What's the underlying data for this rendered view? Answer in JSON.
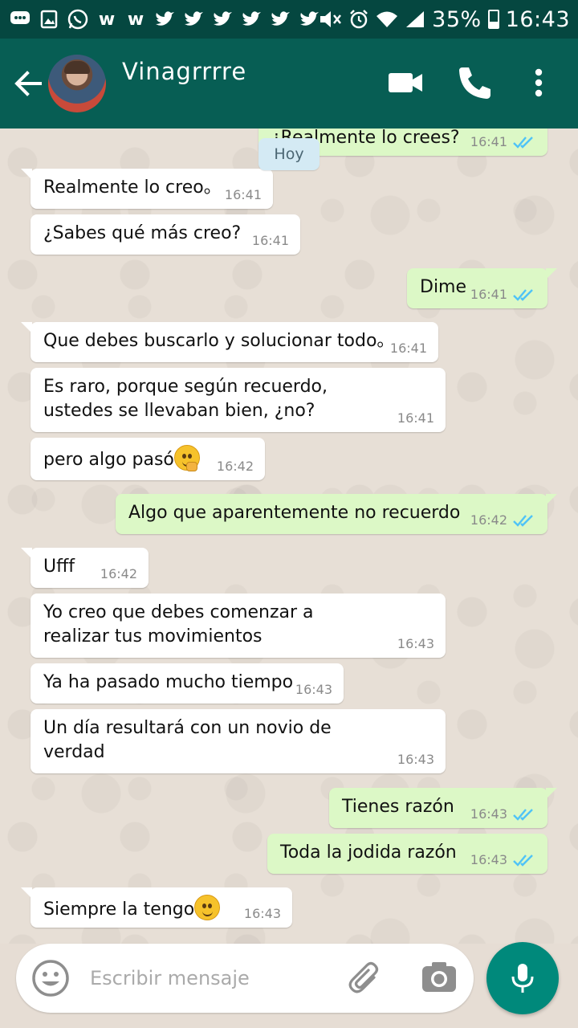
{
  "status_bar": {
    "battery_text": "35%",
    "battery_level": 0.35,
    "time": "16:43",
    "notification_icons": [
      "chat-bubble-icon",
      "image-icon",
      "whatsapp-icon",
      "w-icon",
      "w-icon",
      "twitter-icon",
      "twitter-icon",
      "twitter-icon",
      "twitter-icon",
      "twitter-icon",
      "twitter-icon"
    ],
    "system_icons": [
      "mute-icon",
      "alarm-icon",
      "wifi-icon",
      "signal-icon"
    ]
  },
  "header": {
    "contact_name": "Vinagrrrre",
    "actions": [
      "video-call-icon",
      "phone-icon",
      "more-vert-icon"
    ]
  },
  "date_chip": "Hoy",
  "messages": [
    {
      "dir": "out",
      "text": "¿Realmente lo crees?",
      "time": "16:41",
      "read": true
    },
    {
      "dir": "in",
      "text": "Realmente lo creo。",
      "time": "16:41"
    },
    {
      "dir": "in",
      "text": "¿Sabes qué más creo?",
      "time": "16:41"
    },
    {
      "dir": "out",
      "text": "Dime",
      "time": "16:41",
      "read": true
    },
    {
      "dir": "in",
      "text": "Que debes buscarlo y solucionar todo。",
      "time": "16:41"
    },
    {
      "dir": "in",
      "text": "Es raro, porque según recuerdo,\nustedes se llevaban bien, ¿no?",
      "time": "16:41"
    },
    {
      "dir": "in",
      "text": "pero algo pasó",
      "emoji": "thinking-face-emoji",
      "time": "16:42"
    },
    {
      "dir": "out",
      "text": "Algo que aparentemente no recuerdo",
      "time": "16:42",
      "read": true
    },
    {
      "dir": "in",
      "text": "Ufff",
      "time": "16:42"
    },
    {
      "dir": "in",
      "text": "Yo creo que debes comenzar a\nrealizar tus movimientos",
      "time": "16:43"
    },
    {
      "dir": "in",
      "text": "Ya ha pasado mucho tiempo",
      "time": "16:43"
    },
    {
      "dir": "in",
      "text": "Un día resultará con un novio de\nverdad",
      "time": "16:43"
    },
    {
      "dir": "out",
      "text": "Tienes razón",
      "time": "16:43",
      "read": true
    },
    {
      "dir": "out",
      "text": "Toda la jodida razón",
      "time": "16:43",
      "read": true
    },
    {
      "dir": "in",
      "text": "Siempre la tengo",
      "emoji": "slightly-smiling-face-emoji",
      "time": "16:43"
    }
  ],
  "composer": {
    "placeholder": "Escribir mensaje",
    "value": ""
  },
  "colors": {
    "toolbar": "#075e54",
    "status_bar": "#054740",
    "outgoing_bubble": "#dcf8c6",
    "incoming_bubble": "#ffffff",
    "read_ticks": "#4fc3f7",
    "mic_button": "#00897b"
  }
}
